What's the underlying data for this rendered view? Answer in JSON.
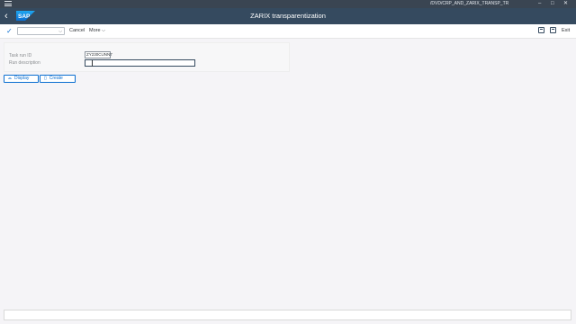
{
  "window": {
    "path": "/DVD/CRP_AND_ZARIX_TRANSP_TR",
    "controls": [
      "–",
      "□",
      "✕"
    ]
  },
  "shell": {
    "logo": "SAP",
    "title": "ZARIX transparentization"
  },
  "toolbar": {
    "select_value": "",
    "cancel_label": "Cancel",
    "more_label": "More",
    "exit_label": "Exit"
  },
  "form": {
    "task_run_id_label": "Task run ID",
    "task_run_id_value": "ZY230CUNN7",
    "run_description_label": "Run description",
    "run_description_value": ""
  },
  "actions": {
    "display_label": "Display",
    "create_label": "Create"
  },
  "status": {
    "message": ""
  },
  "colors": {
    "shell_bg": "#354a5f",
    "accent": "#0a6ed1",
    "page_bg": "#f5f4f7"
  }
}
